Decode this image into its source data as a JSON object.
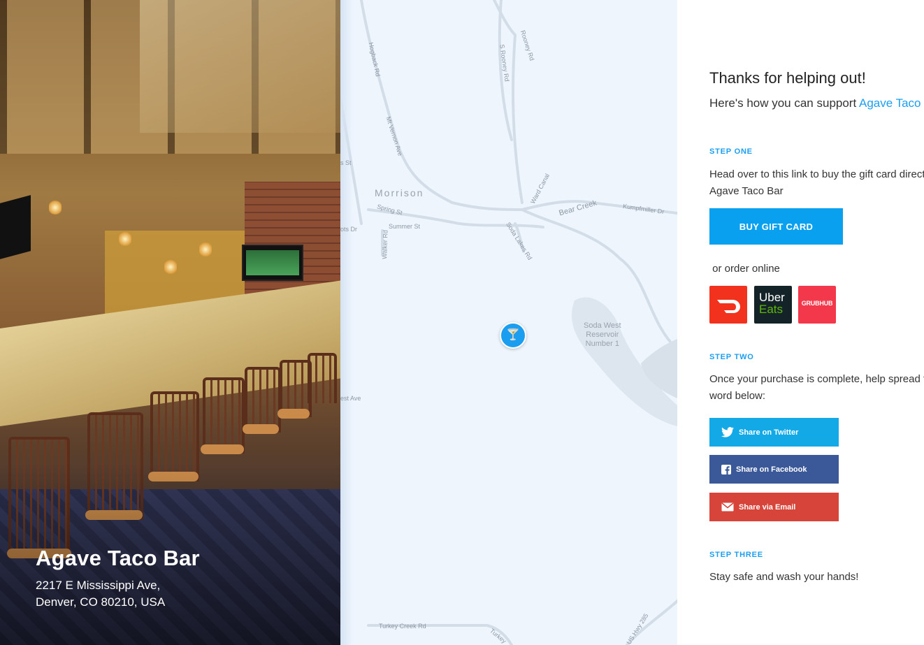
{
  "venue": {
    "name": "Agave Taco Bar",
    "address_line1": "2217 E Mississippi Ave,",
    "address_line2": "Denver, CO 80210, USA"
  },
  "map": {
    "town": "Morrison",
    "lake": "Soda West\nReservoir\nNumber 1",
    "roads": [
      "Hogback Rd",
      "Mt Vernon Ave",
      "S Rooney Rd",
      "Rooney Rd",
      "Ward Canal",
      "Bear Creek",
      "Kumpfmiller Dr",
      "Spring St",
      "Summer St",
      "Walker Rd",
      "Soda Lakes Rd",
      "Turkey Creek Rd",
      "US Hwy 285",
      "est Ave",
      "Turkey",
      "ots Dr",
      "s St"
    ],
    "pin_icon": "cocktail-glass-icon"
  },
  "panel": {
    "title": "Thanks for helping out!",
    "subtitle_prefix": "Here's how you can support ",
    "subtitle_link": "Agave Taco Bar",
    "step_one": "STEP ONE",
    "step_one_text": "Head over to this link to buy the gift card directly from",
    "step_one_link": "Agave Taco Bar",
    "buy_button": "BUY  GIFT CARD",
    "order_online": " or order online",
    "apps": {
      "doordash_icon": "doordash-logo-icon",
      "uber_line1": "Uber",
      "uber_line2": "Eats",
      "grubhub": "GRUBHUB"
    },
    "step_two": "STEP TWO",
    "step_two_line1": "Once your purchase is complete, help spread the",
    "step_two_line2": "word below:",
    "share_twitter": "Share on Twitter",
    "share_facebook": "Share on Facebook",
    "share_email": "Share via Email",
    "step_three": "STEP THREE",
    "step_three_text": "Stay safe and wash your hands!"
  },
  "colors": {
    "accent": "#1b9ef0",
    "twitter": "#12a9e6",
    "facebook": "#3b5998",
    "email": "#d7453a",
    "doordash": "#f3321e",
    "uber": "#142328",
    "uber_eats_green": "#5fb709",
    "grubhub": "#f2384a"
  }
}
